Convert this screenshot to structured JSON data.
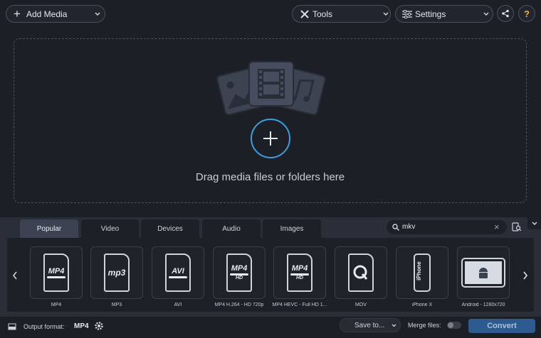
{
  "toolbar": {
    "add_media": "Add Media",
    "tools": "Tools",
    "settings": "Settings",
    "share_icon": "share-icon",
    "help_icon": "help-icon"
  },
  "dropzone": {
    "text": "Drag media files or folders here"
  },
  "tabs": [
    {
      "label": "Popular",
      "active": true
    },
    {
      "label": "Video",
      "active": false
    },
    {
      "label": "Devices",
      "active": false
    },
    {
      "label": "Audio",
      "active": false
    },
    {
      "label": "Images",
      "active": false
    }
  ],
  "search": {
    "value": "mkv"
  },
  "formats": [
    {
      "label": "MP4",
      "icon": "MP4"
    },
    {
      "label": "MP3",
      "icon": "mp3"
    },
    {
      "label": "AVI",
      "icon": "AVI"
    },
    {
      "label": "MP4 H.264 - HD 720p",
      "icon": "MP4 HD"
    },
    {
      "label": "MP4 HEVC - Full HD 1...",
      "icon": "MP4 HD"
    },
    {
      "label": "MOV",
      "icon": "quicktime-icon"
    },
    {
      "label": "iPhone X",
      "icon": "iphone-icon"
    },
    {
      "label": "Android - 1280x720",
      "icon": "android-icon"
    }
  ],
  "status": {
    "output_label": "Output format:",
    "output_value": "MP4",
    "save_to": "Save to...",
    "merge_label": "Merge files:",
    "convert": "Convert"
  },
  "colors": {
    "accent": "#3aa0e0",
    "convert": "#2e5b8f"
  }
}
